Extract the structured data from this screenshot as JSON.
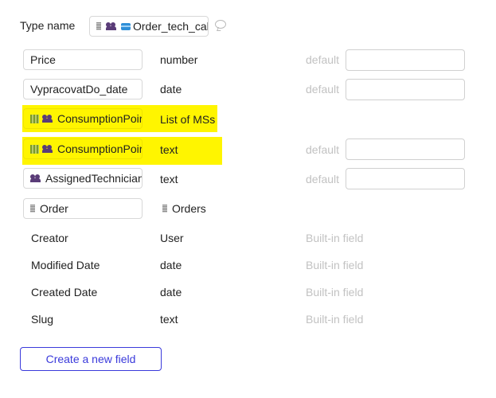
{
  "header": {
    "type_name_label": "Type name",
    "type_name_value": "Order_tech_cal"
  },
  "fields": [
    {
      "name": "Price",
      "type": "number",
      "default_label": "default"
    },
    {
      "name": "VypracovatDo_date",
      "type": "date",
      "default_label": "default"
    },
    {
      "name": "ConsumptionPoir",
      "type": "List of MSs"
    },
    {
      "name": "ConsumptionPoir",
      "type": "text",
      "default_label": "default"
    },
    {
      "name": "AssignedTechnician",
      "type": "text",
      "default_label": "default"
    },
    {
      "name": "Order",
      "type": "Orders"
    }
  ],
  "builtin_fields": [
    {
      "name": "Creator",
      "type": "User",
      "note": "Built-in field"
    },
    {
      "name": "Modified Date",
      "type": "date",
      "note": "Built-in field"
    },
    {
      "name": "Created Date",
      "type": "date",
      "note": "Built-in field"
    },
    {
      "name": "Slug",
      "type": "text",
      "note": "Built-in field"
    }
  ],
  "actions": {
    "create_label": "Create a new field"
  },
  "colors": {
    "highlight": "#fff500",
    "accent": "#3a3adb",
    "muted": "#c2c2c2"
  },
  "icons": {
    "type_name": [
      "document-icon",
      "users-icon",
      "card-icon"
    ],
    "consumption": [
      "building-icon",
      "users-icon"
    ],
    "technician": [
      "users-icon"
    ],
    "order": [
      "document-icon"
    ],
    "comment": "comment-icon"
  }
}
